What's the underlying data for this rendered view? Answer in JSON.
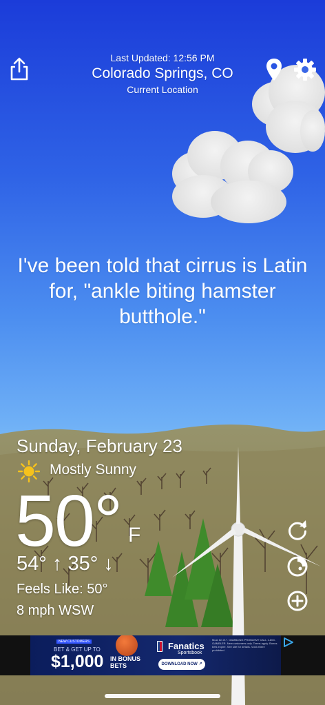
{
  "header": {
    "last_updated": "Last Updated: 12:56 PM",
    "location": "Colorado Springs, CO",
    "location_sub": "Current Location"
  },
  "quote": "I've been told that cirrus is Latin for, \"ankle biting hamster butthole.\"",
  "weather": {
    "date": "Sunday, February 23",
    "condition": "Mostly Sunny",
    "condition_icon": "sun-icon",
    "temperature": "50°",
    "unit": "F",
    "high": "54°",
    "low": "35°",
    "feels_like": "Feels Like: 50°",
    "wind": "8 mph WSW"
  },
  "ad": {
    "top_small": "NEW CUSTOMERS",
    "offer_line": "BET & GET UP TO",
    "amount": "$1,000",
    "bonus_line1": "IN BONUS",
    "bonus_line2": "BETS",
    "brand": "Fanatics",
    "brand_sub": "Sportsbook",
    "cta": "DOWNLOAD NOW ↗",
    "fine_print": "Must be 21+. GAMBLING PROBLEM? CALL 1-800-GAMBLER. New customers only. Terms apply. Bonus bets expire. See site for details. Void where prohibited.",
    "adchoices_icon": "adchoices-icon"
  },
  "colors": {
    "sky_top": "#1b3cd9",
    "sky_bottom": "#86c6fa",
    "ground": "#8e8660",
    "tree_green": "#3e8a2a",
    "sun": "#f6c21c"
  },
  "icons": {
    "share": "share-icon",
    "location": "location-pin-icon",
    "settings": "gear-icon",
    "refresh": "refresh-icon",
    "mode": "mode-toggle-icon",
    "add": "add-icon"
  }
}
